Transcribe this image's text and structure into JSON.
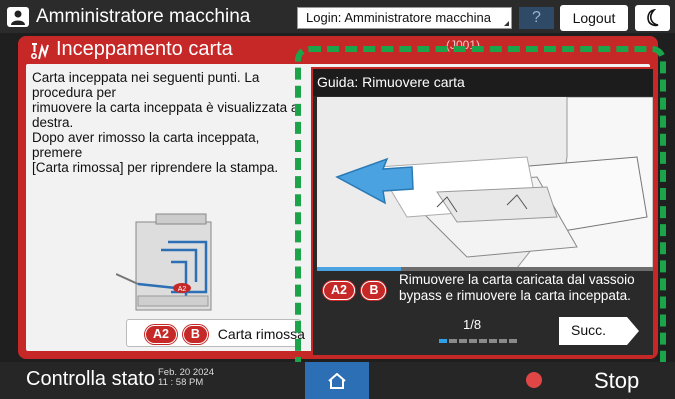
{
  "header": {
    "user_title": "Amministratore macchina",
    "login_text": "Login: Amministratore macchina",
    "help_label": "?",
    "logout_label": "Logout"
  },
  "alert": {
    "title": "Inceppamento carta",
    "code": "(J001)",
    "description": "Carta inceppata nei seguenti punti. La procedura per\nrimuovere la carta inceppata è visualizzata a destra.\nDopo aver rimosso la carta inceppata, premere\n[Carta rimossa] per riprendere la stampa.",
    "location_badge": "A2",
    "paper_removed_button": {
      "badge_a": "A2",
      "badge_b": "B",
      "label": "Carta rimossa"
    }
  },
  "guide": {
    "title": "Guida: Rimuovere carta",
    "instruction": "Rimuovere la carta caricata dal vassoio\nbypass e rimuovere la carta inceppata.",
    "badge_a": "A2",
    "badge_b": "B",
    "page_indicator": "1/8",
    "total_steps": 8,
    "current_step": 1,
    "progress_fraction": 0.25,
    "next_label": "Succ."
  },
  "footer": {
    "status_label": "Controlla stato",
    "date_line1": "Feb. 20 2024",
    "date_line2": "11 : 58 PM",
    "stop_label": "Stop"
  },
  "colors": {
    "alert_red": "#c62828",
    "highlight_green": "#1ba449",
    "progress_blue": "#4aa3e0",
    "home_blue": "#2d6fb5"
  }
}
